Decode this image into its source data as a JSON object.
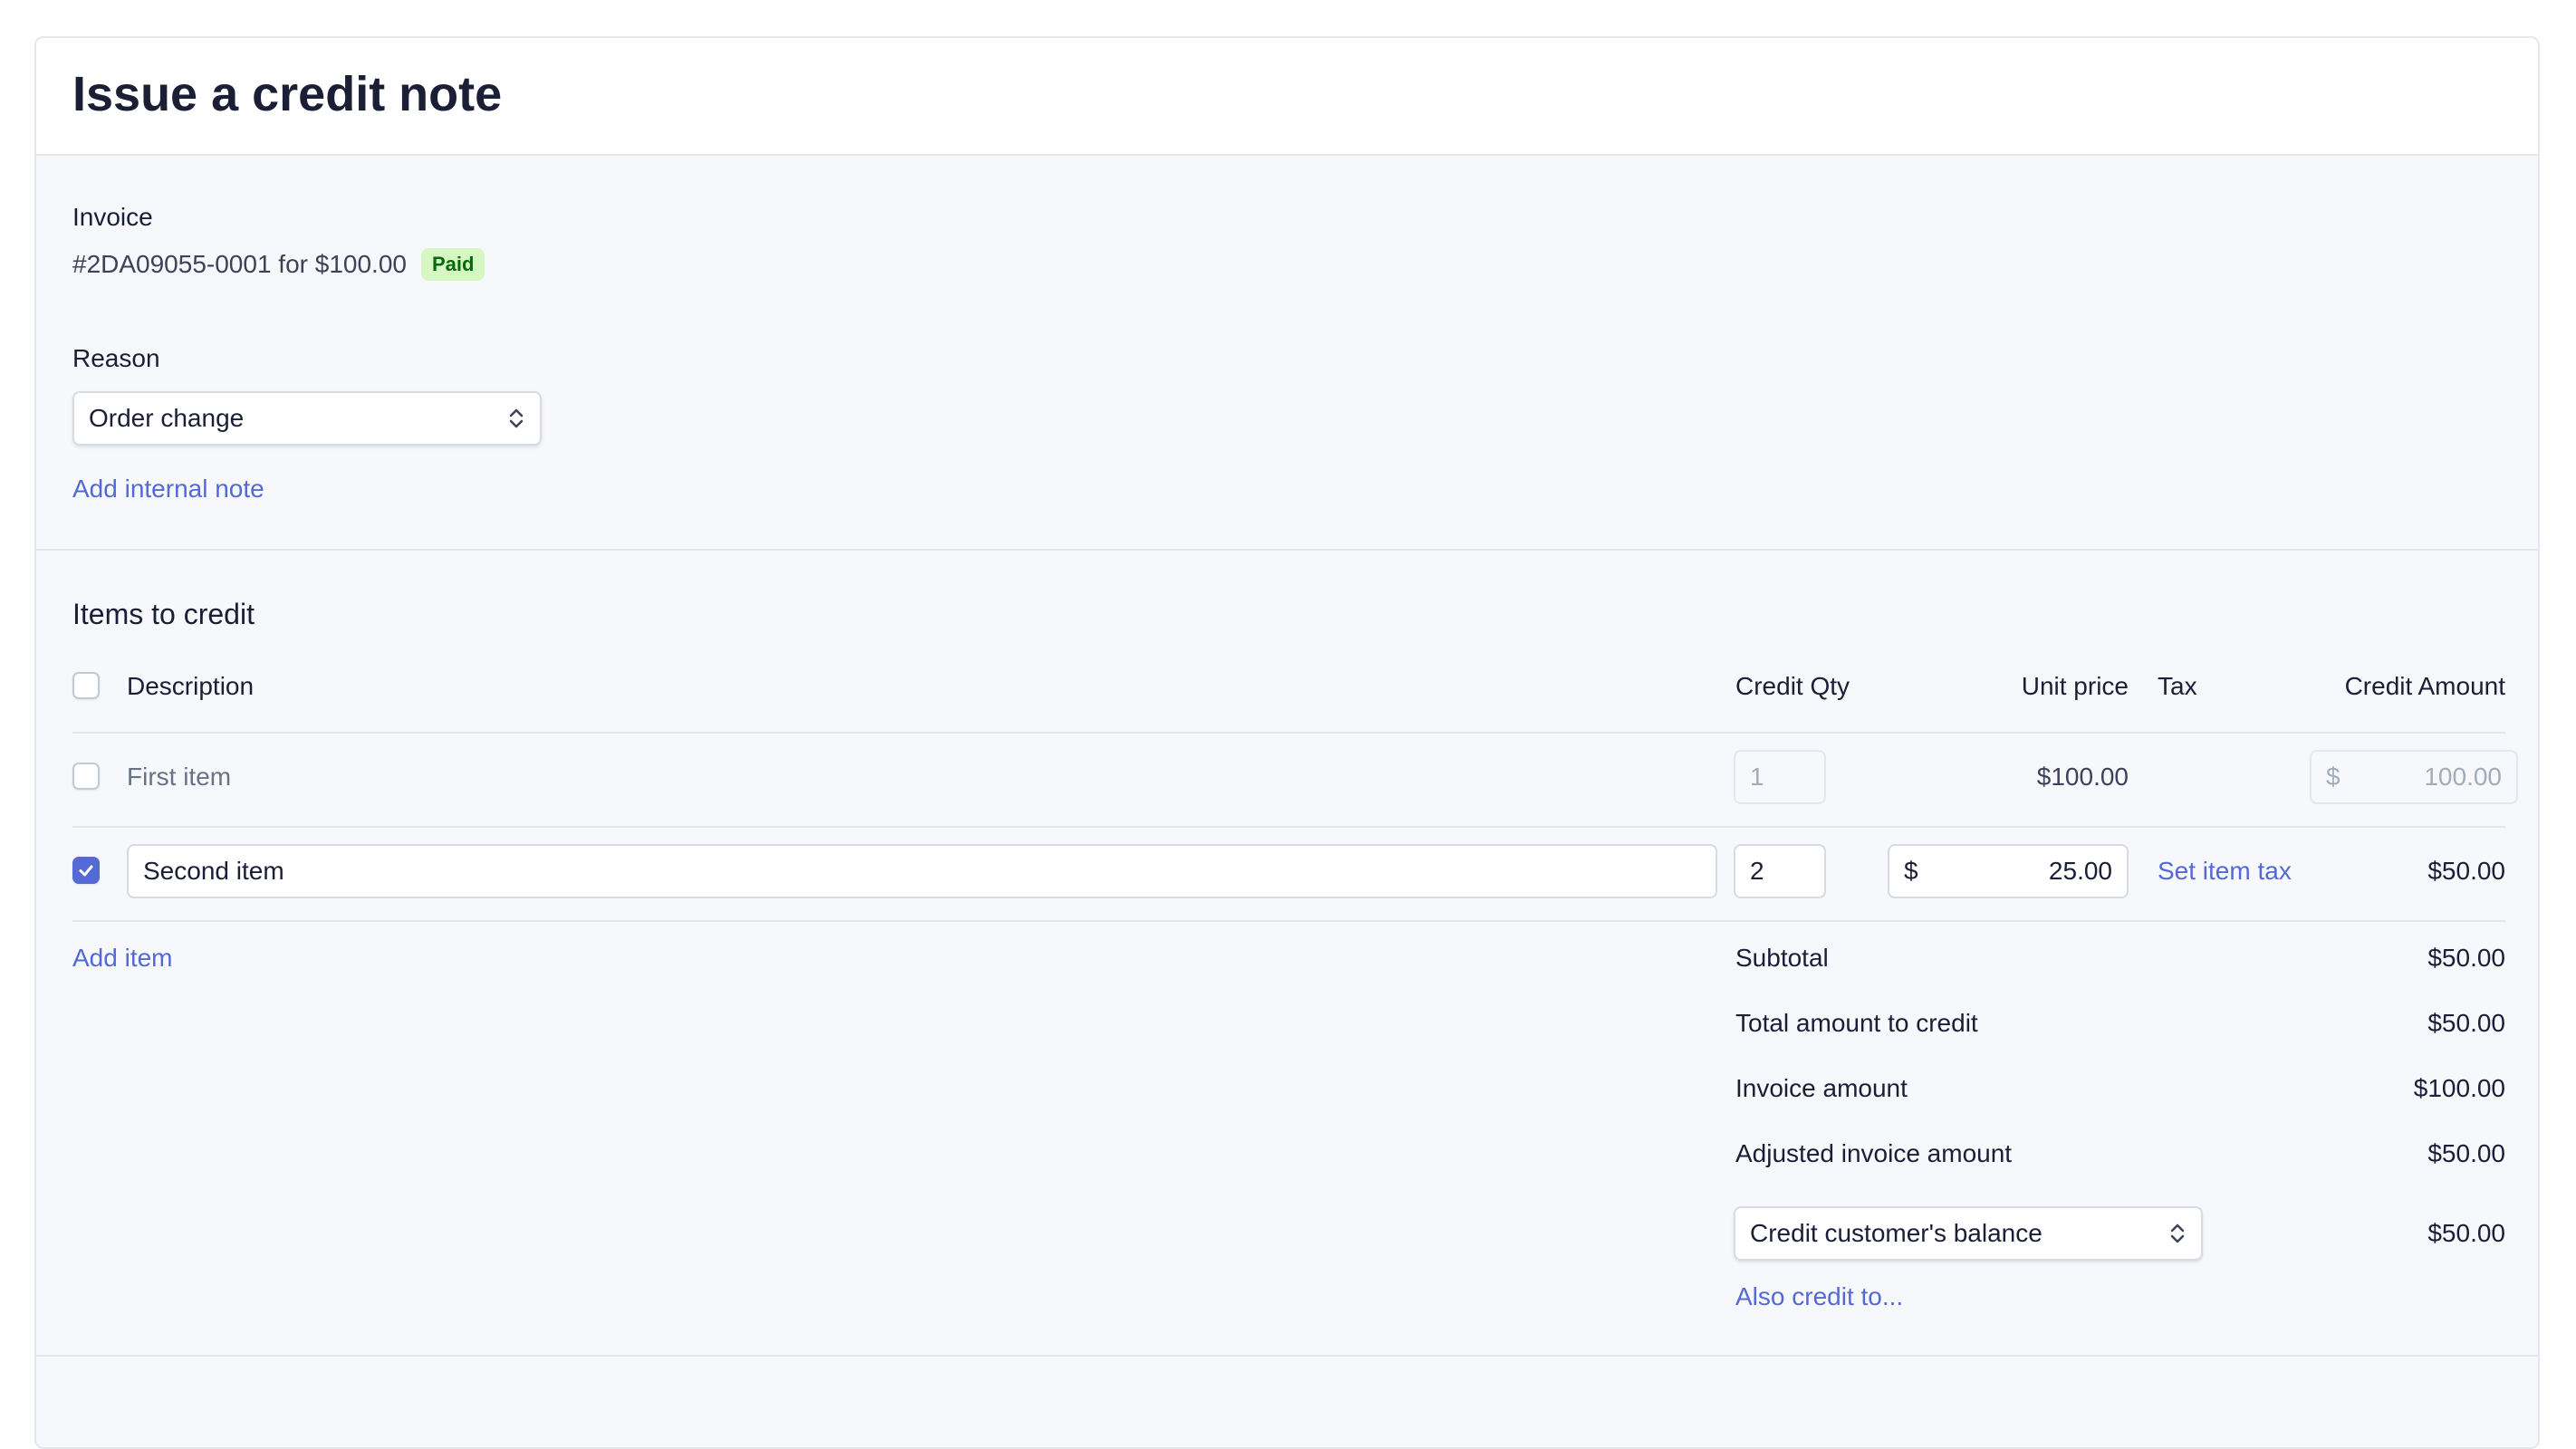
{
  "page": {
    "title": "Issue a credit note"
  },
  "invoice": {
    "label": "Invoice",
    "summary": "#2DA09055-0001 for $100.00",
    "status": "Paid"
  },
  "reason": {
    "label": "Reason",
    "selected": "Order change",
    "add_note": "Add internal note"
  },
  "items": {
    "section_title": "Items to credit",
    "columns": {
      "description": "Description",
      "credit_qty": "Credit Qty",
      "unit_price": "Unit price",
      "tax": "Tax",
      "credit_amount": "Credit Amount"
    },
    "rows": [
      {
        "description": "First item",
        "qty": "1",
        "unit_price": "$100.00",
        "amount_prefix": "$",
        "amount": "100.00",
        "checked": false
      },
      {
        "description": "Second item",
        "qty": "2",
        "unit_price_prefix": "$",
        "unit_price": "25.00",
        "tax_link": "Set item tax",
        "amount": "$50.00",
        "checked": true
      }
    ],
    "add_item": "Add item"
  },
  "summary": {
    "subtotal_label": "Subtotal",
    "subtotal": "$50.00",
    "total_label": "Total amount to credit",
    "total": "$50.00",
    "invoice_label": "Invoice amount",
    "invoice": "$100.00",
    "adjusted_label": "Adjusted invoice amount",
    "adjusted": "$50.00",
    "credit_method": "Credit customer's balance",
    "credit_method_amount": "$50.00",
    "also_credit": "Also credit to..."
  },
  "colors": {
    "accent": "#5469d4",
    "badge_bg": "#d7f7c2",
    "badge_text": "#05690d"
  }
}
